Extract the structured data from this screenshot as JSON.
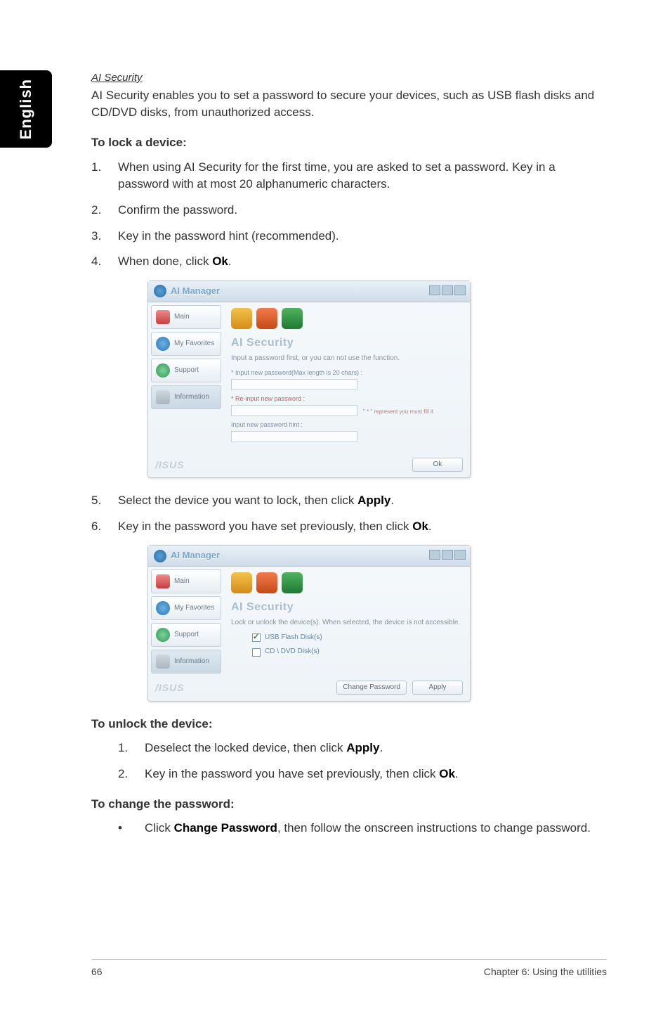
{
  "sideTab": "English",
  "section": {
    "title": "AI Security",
    "intro": "AI Security enables you to set a password to secure your devices, such as USB flash disks and CD/DVD disks, from unauthorized access."
  },
  "lock": {
    "heading": "To lock a device:",
    "steps": [
      "When using AI Security for the first time, you are asked to set a password. Key in a password with at most 20 alphanumeric characters.",
      "Confirm the password.",
      "Key in the password hint (recommended).",
      "When done, click ",
      "Select the device you want to lock, then click ",
      "Key in the password you have set previously, then click "
    ],
    "okWord": "Ok",
    "applyWord": "Apply"
  },
  "unlock": {
    "heading": "To unlock the device:",
    "steps": [
      "Deselect the locked device, then click ",
      "Key in the password you have set previously, then click "
    ]
  },
  "change": {
    "heading": "To change the password:",
    "bulletPrefix": "Click ",
    "changePw": "Change Password",
    "bulletSuffix": ", then follow the onscreen instructions to change password."
  },
  "window1": {
    "title": "AI Manager",
    "nav": {
      "main": "Main",
      "fav": "My Favorites",
      "support": "Support",
      "info": "Information"
    },
    "paneTitle": "AI Security",
    "line1": "Input a password first, or you can not use the function.",
    "lab1": "* Input new password(Max length is 20 chars) :",
    "lab2": "* Re-input new password :",
    "hintNote": "\" * \" represent you must fill it",
    "lab3": "Input new password hint :",
    "brand": "/ISUS",
    "okBtn": "Ok"
  },
  "window2": {
    "title": "AI Manager",
    "paneTitle": "AI Security",
    "line1": "Lock or unlock the device(s). When selected, the device is not accessible.",
    "opt1": "USB Flash Disk(s)",
    "opt2": "CD \\ DVD Disk(s)",
    "brand": "/ISUS",
    "btnChange": "Change Password",
    "btnApply": "Apply"
  },
  "footer": {
    "page": "66",
    "chapter": "Chapter 6: Using the utilities"
  }
}
